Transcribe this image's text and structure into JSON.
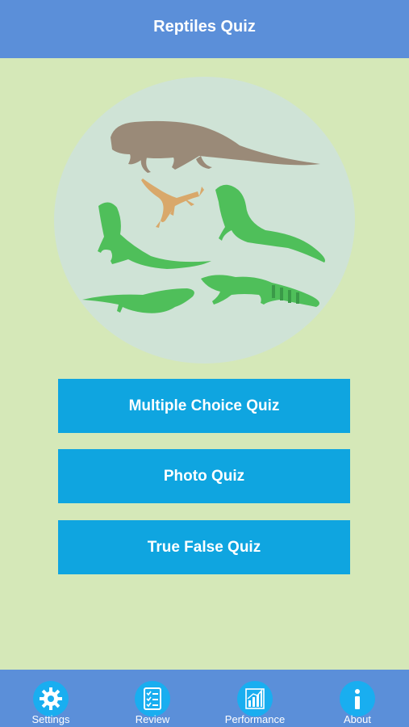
{
  "header": {
    "title": "Reptiles Quiz"
  },
  "hero": {
    "image": "lizards-illustration"
  },
  "menu": {
    "multiple_choice_label": "Multiple Choice Quiz",
    "photo_label": "Photo Quiz",
    "true_false_label": "True False Quiz"
  },
  "tabbar": {
    "settings_label": "Settings",
    "review_label": "Review",
    "performance_label": "Performance",
    "about_label": "About"
  },
  "colors": {
    "header_bg": "#5b8fd9",
    "page_bg": "#d5e8b8",
    "button_bg": "#0fa5e0",
    "icon_bg": "#19aef0",
    "hero_circle": "#cfe3d6"
  }
}
